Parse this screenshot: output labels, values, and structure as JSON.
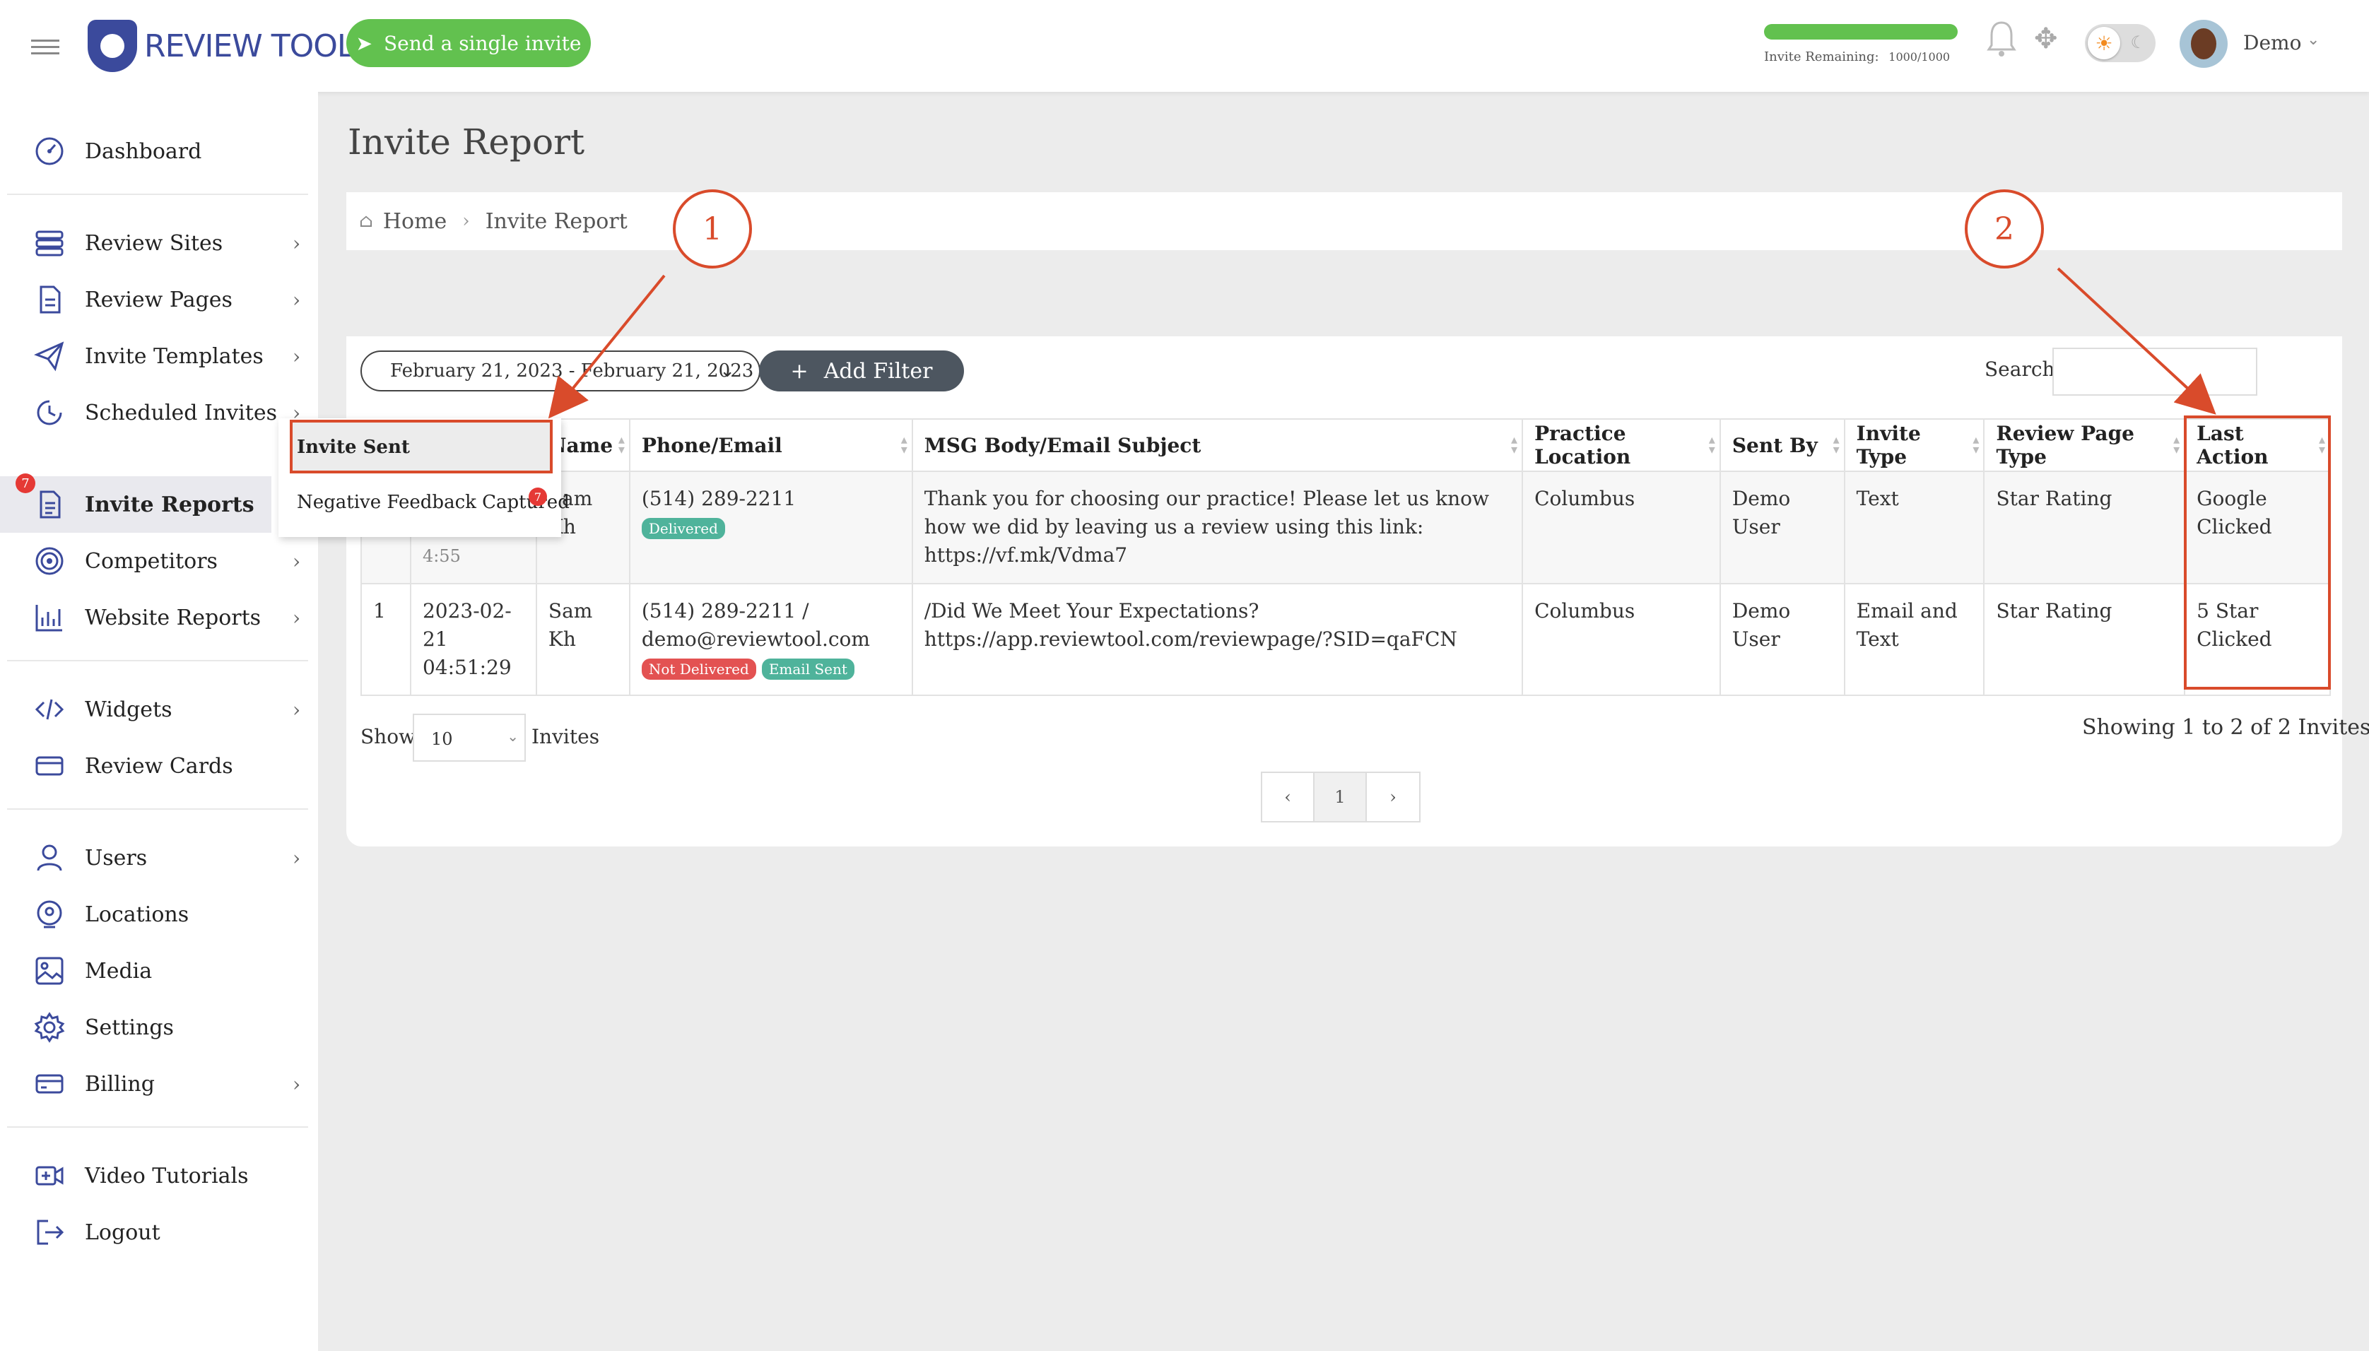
{
  "topbar": {
    "logo_text": "REVIEW TOOL",
    "send_button": "Send a single invite",
    "invite_remaining_label": "Invite Remaining:",
    "invite_remaining_count": "1000/1000",
    "invite_remaining_fraction": 1.0,
    "user_name": "Demo"
  },
  "sidebar": {
    "items": [
      {
        "label": "Dashboard",
        "icon": "gauge-icon"
      },
      {
        "label": "Review Sites",
        "icon": "layers-icon"
      },
      {
        "label": "Review Pages",
        "icon": "page-icon"
      },
      {
        "label": "Invite Templates",
        "icon": "paper-plane-icon"
      },
      {
        "label": "Scheduled Invites",
        "icon": "clock-icon"
      },
      {
        "label": "Invite Reports",
        "icon": "report-icon",
        "badge": "7"
      },
      {
        "label": "Competitors",
        "icon": "target-icon"
      },
      {
        "label": "Website Reports",
        "icon": "bar-chart-icon"
      },
      {
        "label": "Widgets",
        "icon": "code-icon"
      },
      {
        "label": "Review Cards",
        "icon": "card-icon"
      },
      {
        "label": "Users",
        "icon": "user-icon"
      },
      {
        "label": "Locations",
        "icon": "location-pin-icon"
      },
      {
        "label": "Media",
        "icon": "image-icon"
      },
      {
        "label": "Settings",
        "icon": "gear-icon"
      },
      {
        "label": "Billing",
        "icon": "credit-card-icon"
      },
      {
        "label": "Video Tutorials",
        "icon": "video-icon"
      },
      {
        "label": "Logout",
        "icon": "logout-icon"
      }
    ]
  },
  "flyout": {
    "items": [
      {
        "label": "Invite Sent"
      },
      {
        "label": "Negative Feedback Captured",
        "badge": "7"
      }
    ]
  },
  "page": {
    "title": "Invite Report",
    "breadcrumb": [
      "Home",
      "Invite Report"
    ]
  },
  "toolbar": {
    "date_range": "February 21, 2023 - February 21, 2023",
    "add_filter": "Add Filter",
    "search_label": "Search:",
    "search_value": ""
  },
  "table": {
    "headers": [
      "Name",
      "Phone/Email",
      "MSG Body/Email Subject",
      "Practice Location",
      "Sent By",
      "Invite Type",
      "Review Page Type",
      "Last Action"
    ],
    "rows": [
      {
        "id": "",
        "date": "",
        "time_partial": "4:55",
        "name": "Sam Kh",
        "contact": "(514) 289-2211",
        "badges": [
          "Delivered"
        ],
        "message": "Thank you for choosing our practice! Please let us know how we did by leaving us a review using this link: https://vf.mk/Vdma7",
        "location": "Columbus",
        "sent_by": "Demo User",
        "invite_type": "Text",
        "review_page_type": "Star Rating",
        "last_action": "Google Clicked"
      },
      {
        "id": "1",
        "date": "2023-02-21",
        "time": "04:51:29",
        "name": "Sam Kh",
        "contact": "(514) 289-2211 / demo@reviewtool.com",
        "badges": [
          "Not Delivered",
          "Email Sent"
        ],
        "message": "/Did We Meet Your Expectations? https://app.reviewtool.com/reviewpage/?SID=qaFCN",
        "location": "Columbus",
        "sent_by": "Demo User",
        "invite_type": "Email and Text",
        "review_page_type": "Star Rating",
        "last_action": "5 Star Clicked"
      }
    ]
  },
  "footer": {
    "show_label": "Show",
    "page_size": "10",
    "invites_label": "Invites",
    "showing_text": "Showing 1 to 2 of 2 Invites",
    "pager": {
      "prev": "‹",
      "current": "1",
      "next": "›"
    }
  },
  "annotations": {
    "callout_1": "1",
    "callout_2": "2",
    "color": "#d94b2b"
  },
  "colors": {
    "brand": "#3b4a9c",
    "send_button": "#62c14f",
    "filter_button": "#4d5660",
    "delivered": "#4fb39b",
    "not_delivered": "#e35252"
  }
}
